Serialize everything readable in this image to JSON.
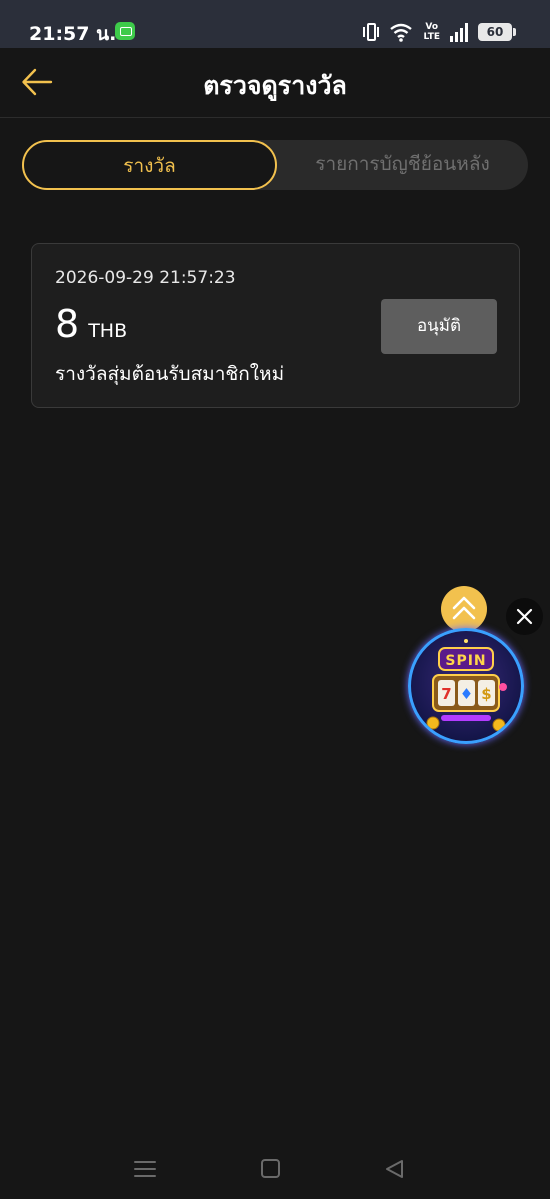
{
  "status_bar": {
    "time": "21:57 น.",
    "volte_line1": "Vo",
    "volte_line2": "LTE",
    "battery": "60"
  },
  "header": {
    "back_icon": "arrow-left-icon",
    "title": "ตรวจดูรางวัล"
  },
  "tabs": [
    {
      "label": "รางวัล",
      "active": true
    },
    {
      "label": "รายการบัญชีย้อนหลัง",
      "active": false
    }
  ],
  "rewards": [
    {
      "date": "2026-09-29 21:57:23",
      "amount": "8",
      "currency": "THB",
      "name": "รางวัลสุ่มต้อนรับสมาชิกใหม่",
      "action_label": "อนุมัติ"
    }
  ],
  "floating_widget": {
    "label": "SPIN",
    "collapse_icon": "chevron-up-icon",
    "close_icon": "close-icon",
    "reels": [
      "7",
      "♦",
      "$"
    ]
  },
  "nav_bar": {
    "icons": [
      "menu-icon",
      "home-icon",
      "back-icon"
    ]
  },
  "colors": {
    "background": "#161616",
    "accent": "#f2c14e",
    "card": "#1e1e1e",
    "button_disabled": "#5e5e5e"
  }
}
